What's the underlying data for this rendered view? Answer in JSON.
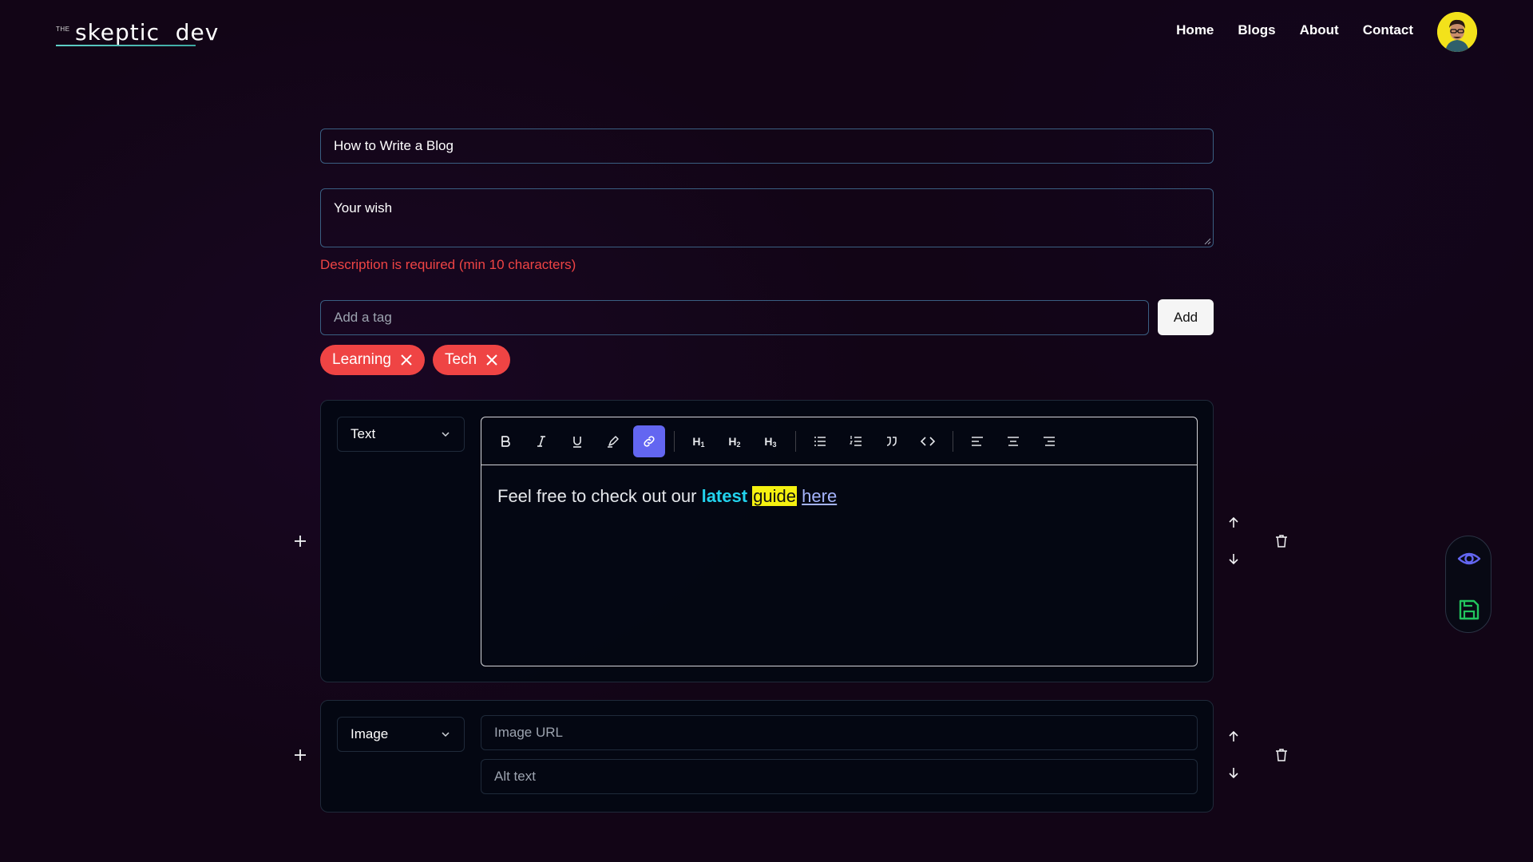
{
  "nav": {
    "logo_prefix": "THE",
    "logo_text": "skeptic  dev",
    "links": [
      "Home",
      "Blogs",
      "About",
      "Contact"
    ]
  },
  "form": {
    "title_value": "How to Write a Blog",
    "description_value": "Your wish",
    "description_error": "Description is required (min 10 characters)",
    "tag_placeholder": "Add a tag",
    "add_label": "Add",
    "tags": [
      "Learning",
      "Tech"
    ]
  },
  "blocks": {
    "text_block": {
      "type_label": "Text",
      "content": {
        "prefix": "Feel free to check out our ",
        "bold_colored": "latest",
        "highlighted": "guide",
        "link": "here"
      },
      "toolbar": [
        "bold",
        "italic",
        "underline",
        "highlight",
        "link",
        "h1",
        "h2",
        "h3",
        "bullet-list",
        "ordered-list",
        "blockquote",
        "code",
        "align-left",
        "align-center",
        "align-right"
      ],
      "active_tool": "link"
    },
    "image_block": {
      "type_label": "Image",
      "url_placeholder": "Image URL",
      "alt_placeholder": "Alt text"
    }
  },
  "colors": {
    "background": "#120516",
    "accent_link": "#6366f1",
    "error": "#ef4444",
    "tag_bg": "#ef4444",
    "text_cyan": "#22d3ee",
    "highlight_yellow": "#f5f110",
    "save_green": "#22c55e",
    "preview_blue": "#6366f1"
  }
}
